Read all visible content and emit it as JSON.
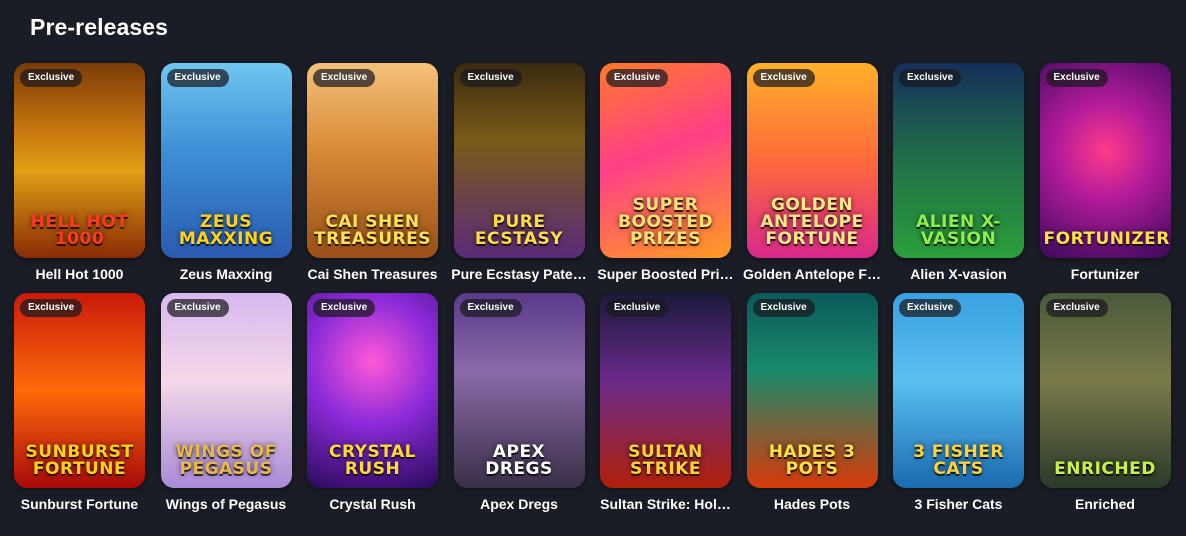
{
  "section": {
    "title": "Pre-releases"
  },
  "badge_label": "Exclusive",
  "games": [
    {
      "name": "Hell Hot 1000",
      "logo": "HELL HOT 1000",
      "bg": "linear-gradient(180deg,#7a3b08 0%,#c8770e 35%,#e0a015 55%,#8a2b06 100%)",
      "logo_color": "#ff3b1f"
    },
    {
      "name": "Zeus Maxxing",
      "logo": "ZEUS MAXXING",
      "bg": "linear-gradient(180deg,#6fc6f0 0%,#3d8fd6 45%,#2a5bb0 100%)",
      "logo_color": "#ffd21a"
    },
    {
      "name": "Cai Shen Treasures",
      "logo": "CAI SHEN TREASURES",
      "bg": "linear-gradient(180deg,#f4c27a 0%,#d88a35 45%,#9a5018 100%)",
      "logo_color": "#ffe15a"
    },
    {
      "name": "Pure Ecstasy Pate…",
      "logo": "PURE ECSTASY",
      "bg": "linear-gradient(180deg,#3a2a10 0%,#7a5a18 40%,#5a2a7a 100%)",
      "logo_color": "#ffdd44"
    },
    {
      "name": "Super Boosted Pri…",
      "logo": "SUPER BOOSTED PRIZES",
      "bg": "linear-gradient(160deg,#ff7a2a 0%,#ff3f88 45%,#ff9d1f 100%)",
      "logo_color": "#ffe27a"
    },
    {
      "name": "Golden Antelope F…",
      "logo": "GOLDEN ANTELOPE FORTUNE",
      "bg": "linear-gradient(180deg,#ffb02a 0%,#ff6a3a 50%,#d8288a 100%)",
      "logo_color": "#ffe88a"
    },
    {
      "name": "Alien X-vasion",
      "logo": "ALIEN X-VASION",
      "bg": "linear-gradient(180deg,#152e5a 0%,#1f6a4a 45%,#2aa03a 100%)",
      "logo_color": "#8df04a"
    },
    {
      "name": "Fortunizer",
      "logo": "FORTUNIZER",
      "bg": "radial-gradient(circle at 50% 45%,#ff3a8a 0%,#b01a9a 40%,#3a0a5a 100%)",
      "logo_color": "#ffe04a"
    },
    {
      "name": "Sunburst Fortune",
      "logo": "SUNBURST FORTUNE",
      "bg": "linear-gradient(180deg,#c81a0a 0%,#ff6a0a 50%,#a80a0a 100%)",
      "logo_color": "#ffd21a"
    },
    {
      "name": "Wings of Pegasus",
      "logo": "WINGS OF PEGASUS",
      "bg": "linear-gradient(180deg,#d9b8f0 0%,#f4d8e8 45%,#a98ad8 100%)",
      "logo_color": "#e8b84a"
    },
    {
      "name": "Crystal Rush",
      "logo": "CRYSTAL RUSH",
      "bg": "radial-gradient(circle at 50% 35%,#ff58d8 0%,#8a2ad8 45%,#2a0a5a 100%)",
      "logo_color": "#ffd83a"
    },
    {
      "name": "Apex Dregs",
      "logo": "APEX DREGS",
      "bg": "linear-gradient(180deg,#5a3a8a 0%,#8a6aa8 40%,#3a3048 100%)",
      "logo_color": "#ffffff"
    },
    {
      "name": "Sultan Strike: Hol…",
      "logo": "SULTAN STRIKE",
      "bg": "linear-gradient(180deg,#1a1a3a 0%,#6a2a8a 45%,#b0200a 100%)",
      "logo_color": "#ffd23a"
    },
    {
      "name": "Hades Pots",
      "logo": "HADES 3 POTS",
      "bg": "linear-gradient(180deg,#0a5a5a 0%,#1a8a6a 40%,#d83a0a 100%)",
      "logo_color": "#ffe04a"
    },
    {
      "name": "3 Fisher Cats",
      "logo": "3 FISHER CATS",
      "bg": "linear-gradient(180deg,#3aa0e0 0%,#5ac0f0 45%,#1a6ab0 100%)",
      "logo_color": "#ffd23a"
    },
    {
      "name": "Enriched",
      "logo": "ENRICHED",
      "bg": "linear-gradient(180deg,#4a5a3a 0%,#7a7a4a 45%,#2a3a2a 100%)",
      "logo_color": "#c8f04a"
    }
  ]
}
